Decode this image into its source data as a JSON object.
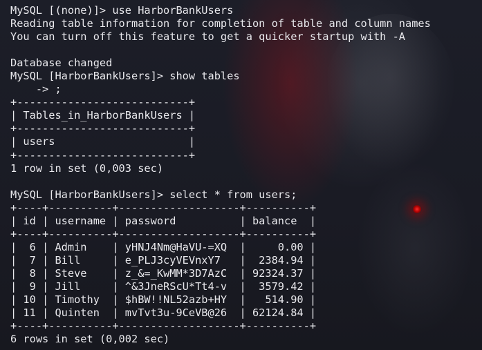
{
  "terminal": {
    "lines": [
      "MySQL [(none)]> use HarborBankUsers",
      "Reading table information for completion of table and column names",
      "You can turn off this feature to get a quicker startup with -A",
      "",
      "Database changed",
      "MySQL [HarborBankUsers]> show tables",
      "    -> ;",
      "+---------------------------+",
      "| Tables_in_HarborBankUsers |",
      "+---------------------------+",
      "| users                     |",
      "+---------------------------+",
      "1 row in set (0,003 sec)",
      "",
      "MySQL [HarborBankUsers]> select * from users;",
      "+----+----------+-------------------+----------+",
      "| id | username | password          | balance  |",
      "+----+----------+-------------------+----------+",
      "|  6 | Admin    | yHNJ4Nm@HaVU-=XQ  |     0.00 |",
      "|  7 | Bill     | e_PLJ3cyVEVnxY7   |  2384.94 |",
      "|  8 | Steve    | z_&=_KwMM*3D7AzC  | 92324.37 |",
      "|  9 | Jill     | ^&3JneRScU*Tt4-v  |  3579.42 |",
      "| 10 | Timothy  | $hBW!!NL52azb+HY  |   514.90 |",
      "| 11 | Quinten  | mvTvt3u-9CeVB@26  | 62124.84 |",
      "+----+----------+-------------------+----------+",
      "6 rows in set (0,002 sec)"
    ]
  }
}
